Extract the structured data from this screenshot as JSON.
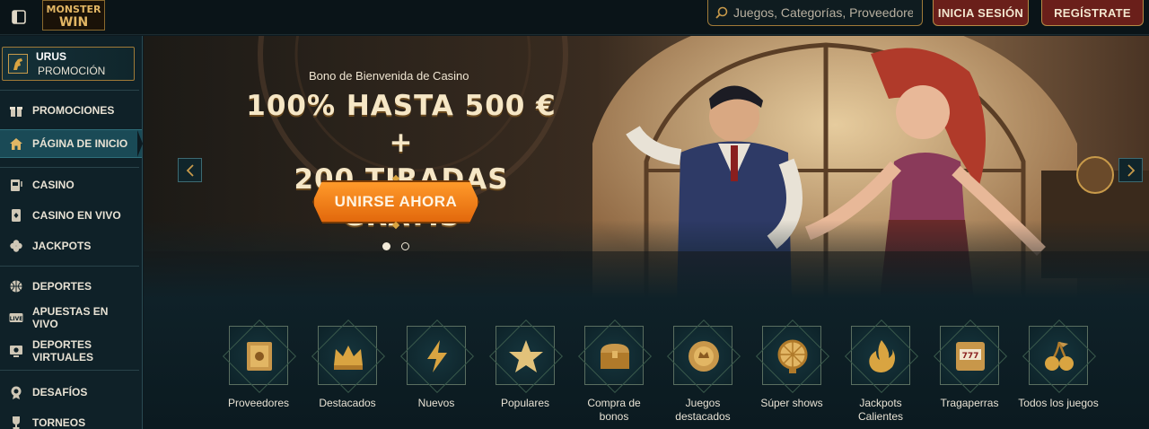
{
  "header": {
    "logo_text": "MONSTER WIN",
    "search_placeholder": "Juegos, Categorías, Proveedores",
    "login_label": "INICIA SESIÓN",
    "register_label": "REGÍSTRATE"
  },
  "sidebar": {
    "promo_card": {
      "title": "URUS",
      "subtitle": "PROMOCIÓN"
    },
    "items": [
      {
        "label": "PROMOCIONES",
        "icon": "gift-icon"
      },
      {
        "label": "PÁGINA DE INICIO",
        "icon": "home-icon",
        "active": true
      },
      {
        "label": "CASINO",
        "icon": "slot-machine-icon"
      },
      {
        "label": "CASINO EN VIVO",
        "icon": "live-casino-icon"
      },
      {
        "label": "JACKPOTS",
        "icon": "clover-icon"
      },
      {
        "label": "DEPORTES",
        "icon": "basketball-icon"
      },
      {
        "label": "APUESTAS EN VIVO",
        "icon": "live-badge-icon"
      },
      {
        "label": "DEPORTES VIRTUALES",
        "icon": "virtual-sports-icon"
      },
      {
        "label": "DESAFÍOS",
        "icon": "medal-icon"
      },
      {
        "label": "TORNEOS",
        "icon": "trophy-icon"
      }
    ]
  },
  "hero": {
    "subtitle": "Bono de Bienvenida de Casino",
    "title_line1": "100% HASTA 500 € +",
    "title_line2": "200 TIRADAS GRATIS",
    "cta_label": "UNIRSE AHORA",
    "slides_total": 2,
    "active_slide": 1
  },
  "categories": [
    {
      "label": "Proveedores",
      "icon": "book-icon"
    },
    {
      "label": "Destacados",
      "icon": "crown-icon"
    },
    {
      "label": "Nuevos",
      "icon": "lightning-icon"
    },
    {
      "label": "Populares",
      "icon": "star-icon"
    },
    {
      "label": "Compra de bonos",
      "icon": "treasure-chest-icon"
    },
    {
      "label": "Juegos destacados",
      "icon": "poker-chip-icon"
    },
    {
      "label": "Súper shows",
      "icon": "wheel-icon"
    },
    {
      "label": "Jackpots Calientes",
      "icon": "flame-icon"
    },
    {
      "label": "Tragaperras",
      "icon": "slot-777-icon"
    },
    {
      "label": "Todos los juegos",
      "icon": "cherries-icon"
    }
  ],
  "colors": {
    "accent_gold": "#c89a4a",
    "button_red": "#6a1f1a",
    "cta_orange": "#f08a1c",
    "sidebar_bg": "#0f2128",
    "active_item": "#1a4a56"
  }
}
